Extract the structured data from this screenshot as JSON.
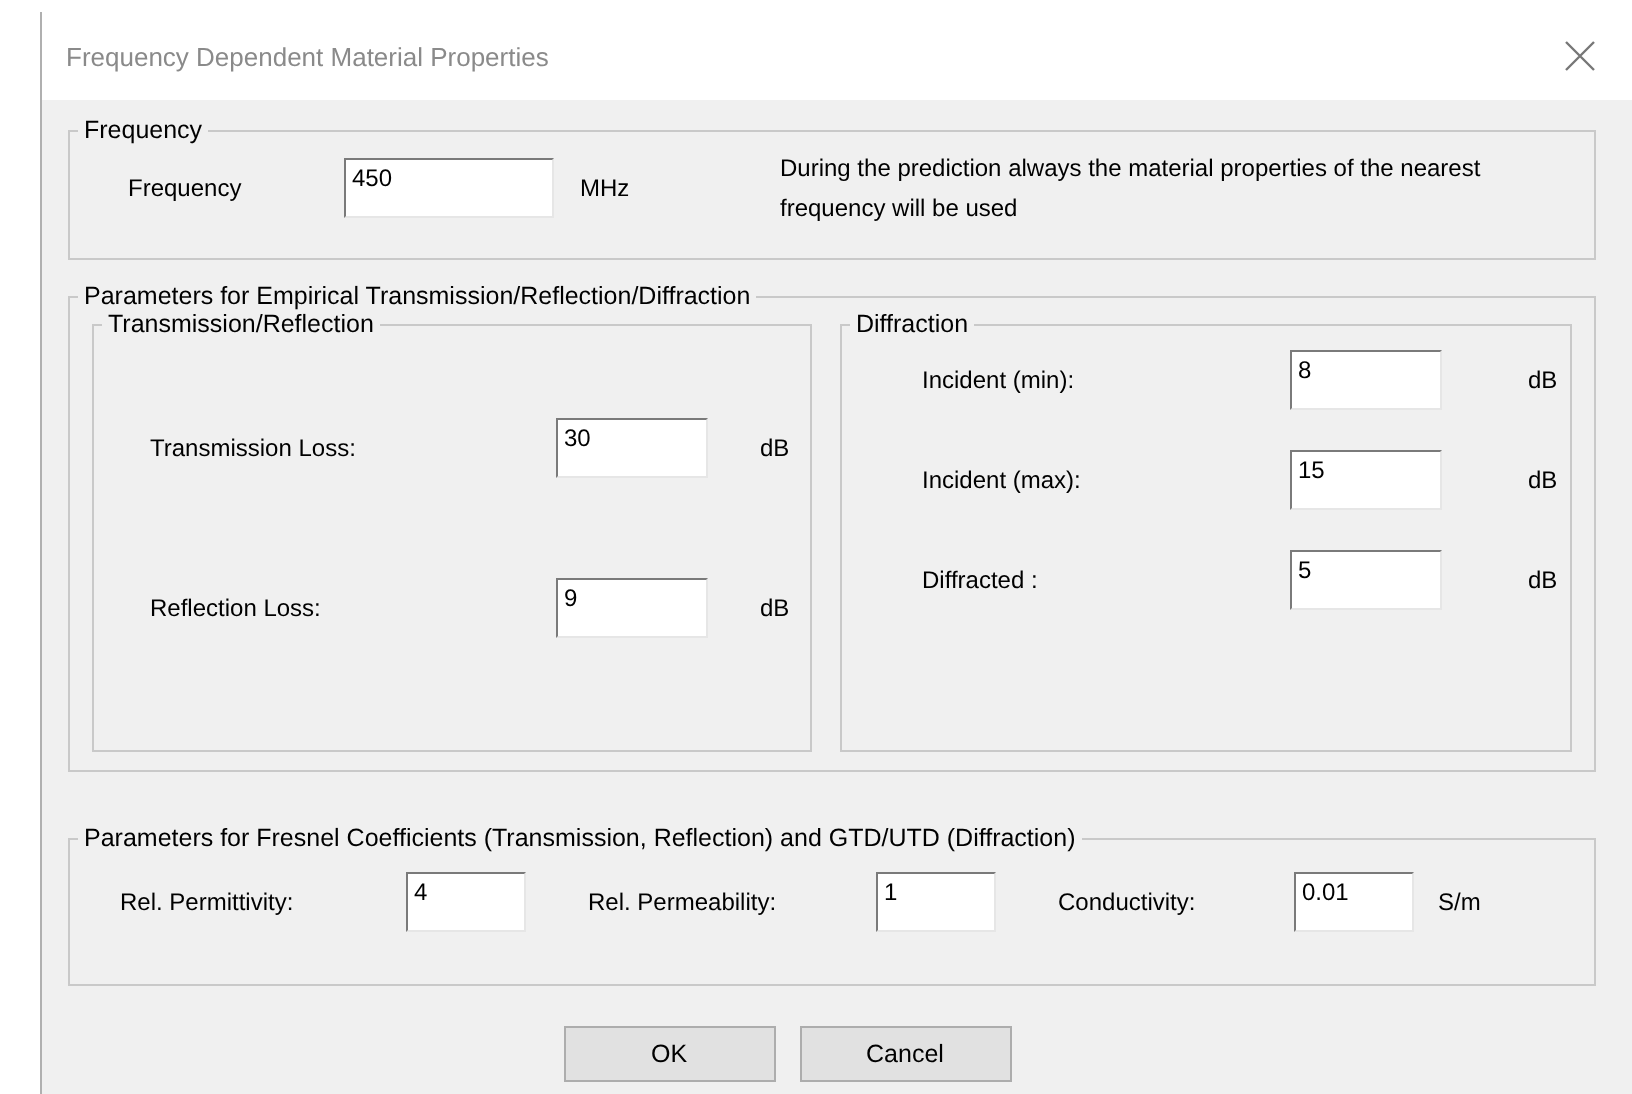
{
  "window": {
    "title": "Frequency Dependent Material Properties"
  },
  "frequency_group": {
    "title": "Frequency",
    "field": {
      "label": "Frequency",
      "value": "450",
      "unit": "MHz"
    },
    "note": "During the prediction always the material properties of the nearest frequency will be used"
  },
  "empirical_group": {
    "title": "Parameters for Empirical Transmission/Reflection/Diffraction",
    "subgroups": [
      {
        "title": "Transmission/Reflection",
        "fields": [
          {
            "label": "Transmission Loss:",
            "value": "30",
            "unit": "dB"
          },
          {
            "label": "Reflection Loss:",
            "value": "9",
            "unit": "dB"
          }
        ]
      },
      {
        "title": "Diffraction",
        "fields": [
          {
            "label": "Incident (min):",
            "value": "8",
            "unit": "dB"
          },
          {
            "label": "Incident (max):",
            "value": "15",
            "unit": "dB"
          },
          {
            "label": "Diffracted :",
            "value": "5",
            "unit": "dB"
          }
        ]
      }
    ]
  },
  "fresnel_group": {
    "title": "Parameters for Fresnel Coefficients (Transmission, Reflection) and GTD/UTD (Diffraction)",
    "fields": [
      {
        "label": "Rel. Permittivity:",
        "value": "4"
      },
      {
        "label": "Rel. Permeability:",
        "value": "1"
      },
      {
        "label": "Conductivity:",
        "value": "0.01",
        "unit": "S/m"
      }
    ]
  },
  "buttons": [
    "OK",
    "Cancel"
  ]
}
